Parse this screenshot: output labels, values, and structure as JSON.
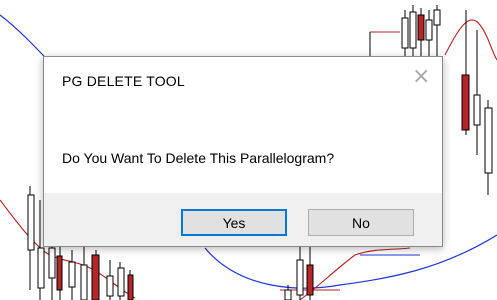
{
  "dialog": {
    "title": "PG DELETE TOOL",
    "close_label": "×",
    "message": "Do You Want To Delete This Parallelogram?",
    "yes_label": "Yes",
    "no_label": "No"
  },
  "colors": {
    "indicator_blue": "#1f35d6",
    "indicator_red": "#b22222",
    "candle_red": "#b3262a",
    "candle_outline": "#000000",
    "button_focus": "#0078d7"
  }
}
